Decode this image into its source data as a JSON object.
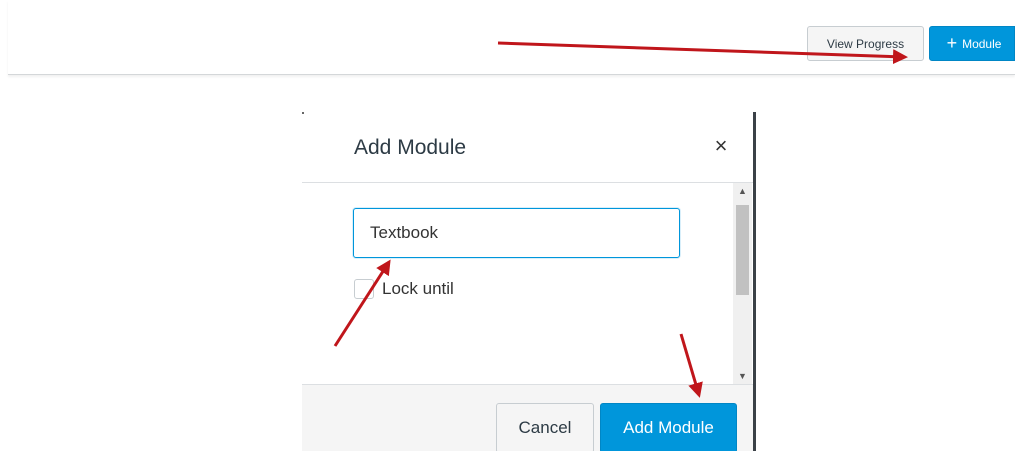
{
  "toolbar": {
    "view_progress_label": "View Progress",
    "add_module_plus": "+",
    "add_module_label": "Module"
  },
  "dialog": {
    "title": "Add Module",
    "close_glyph": "×",
    "name_value": "Textbook",
    "lock_label": "Lock until",
    "cancel_label": "Cancel",
    "submit_label": "Add Module",
    "scroll_up_glyph": "▲",
    "scroll_down_glyph": "▼"
  },
  "colors": {
    "primary_button": "#0096db",
    "annotation_arrow": "#c0161b",
    "text": "#2d3b45"
  },
  "icons": {
    "plus": "plus-icon",
    "close": "close-icon",
    "arrow": "annotation-arrow-icon"
  }
}
